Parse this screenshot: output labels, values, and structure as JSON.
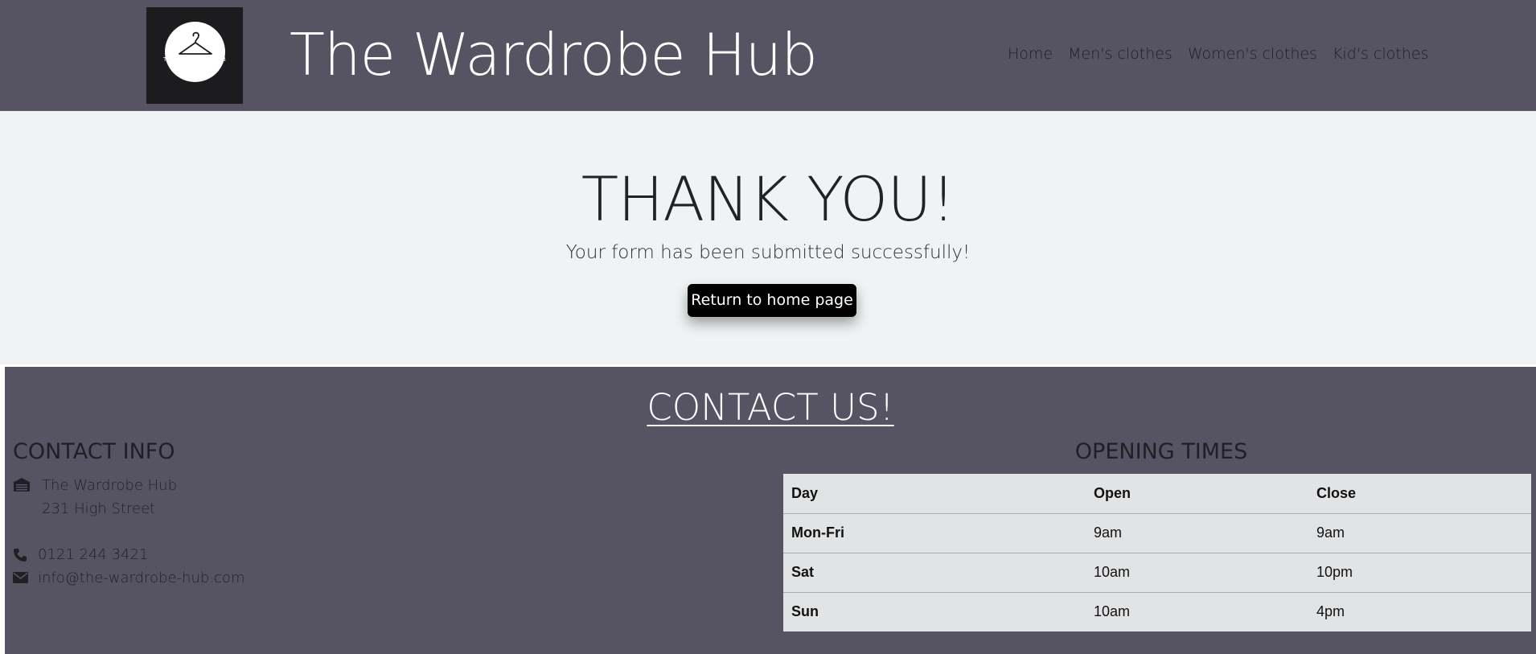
{
  "header": {
    "logo_text": "THE WARDROBE HUB",
    "site_title": "The Wardrobe Hub",
    "nav": [
      {
        "label": "Home"
      },
      {
        "label": "Men's clothes"
      },
      {
        "label": "Women's clothes"
      },
      {
        "label": "Kid's clothes"
      }
    ]
  },
  "hero": {
    "title": "THANK YOU!",
    "subtitle": "Your form has been submitted successfully!",
    "button_label": "Return to home page"
  },
  "contact": {
    "title": "CONTACT US!",
    "info_heading": "CONTACT INFO",
    "address_line1": "The Wardrobe Hub",
    "address_line2": "231 High Street",
    "phone": "0121 244 3421",
    "email": "info@the-wardrobe-hub.com",
    "icons": {
      "address": "building-icon",
      "phone": "phone-icon",
      "email": "envelope-icon"
    },
    "hours_heading": "OPENING TIMES",
    "hours_columns": [
      "Day",
      "Open",
      "Close"
    ],
    "hours_rows": [
      [
        "Mon-Fri",
        "9am",
        "9am"
      ],
      [
        "Sat",
        "10am",
        "10pm"
      ],
      [
        "Sun",
        "10am",
        "4pm"
      ]
    ]
  },
  "colors": {
    "header_bg": "#565463",
    "hero_bg": "#eff3f4",
    "button_bg": "#000000",
    "table_bg": "#e2e3e5"
  }
}
